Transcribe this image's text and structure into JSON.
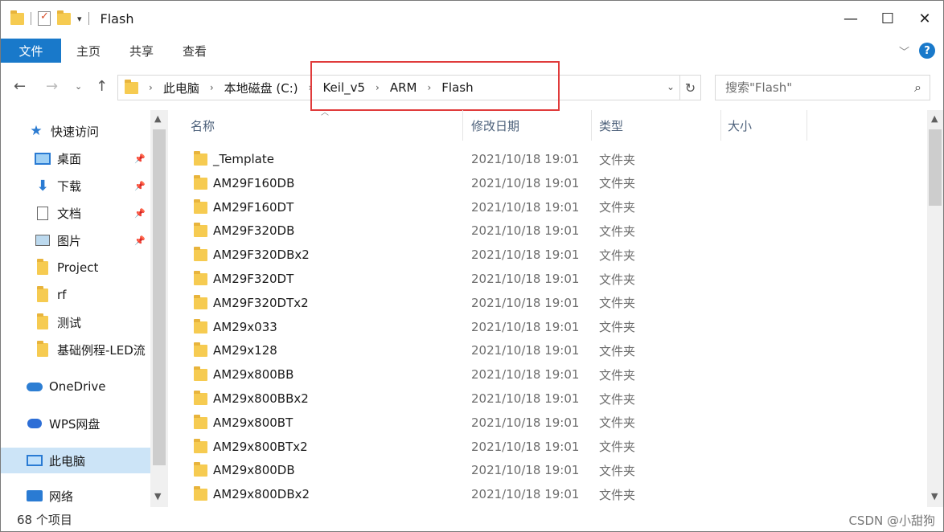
{
  "window": {
    "title": "Flash",
    "minimize": "—",
    "maximize": "☐",
    "close": "✕"
  },
  "ribbon": {
    "file": "文件",
    "tabs": [
      "主页",
      "共享",
      "查看"
    ]
  },
  "address": {
    "crumbs": [
      "此电脑",
      "本地磁盘 (C:)",
      "Keil_v5",
      "ARM",
      "Flash"
    ]
  },
  "search": {
    "placeholder": "搜索\"Flash\""
  },
  "sidebar": {
    "items": [
      {
        "label": "快速访问",
        "icon": "star-icon"
      },
      {
        "label": "桌面",
        "icon": "desktop-icon",
        "pinned": true
      },
      {
        "label": "下载",
        "icon": "download-icon",
        "pinned": true
      },
      {
        "label": "文档",
        "icon": "document-icon",
        "pinned": true
      },
      {
        "label": "图片",
        "icon": "pictures-icon",
        "pinned": true
      },
      {
        "label": "Project",
        "icon": "folder-icon"
      },
      {
        "label": "rf",
        "icon": "folder-icon"
      },
      {
        "label": "测试",
        "icon": "folder-icon"
      },
      {
        "label": "基础例程-LED流",
        "icon": "folder-icon"
      },
      {
        "label": "OneDrive",
        "icon": "onedrive-icon"
      },
      {
        "label": "WPS网盘",
        "icon": "wps-cloud-icon"
      },
      {
        "label": "此电脑",
        "icon": "this-pc-icon",
        "selected": true
      },
      {
        "label": "网络",
        "icon": "network-icon"
      }
    ]
  },
  "columns": {
    "name": "名称",
    "date": "修改日期",
    "type": "类型",
    "size": "大小"
  },
  "files": [
    {
      "name": "_Template",
      "date": "2021/10/18 19:01",
      "type": "文件夹"
    },
    {
      "name": "AM29F160DB",
      "date": "2021/10/18 19:01",
      "type": "文件夹"
    },
    {
      "name": "AM29F160DT",
      "date": "2021/10/18 19:01",
      "type": "文件夹"
    },
    {
      "name": "AM29F320DB",
      "date": "2021/10/18 19:01",
      "type": "文件夹"
    },
    {
      "name": "AM29F320DBx2",
      "date": "2021/10/18 19:01",
      "type": "文件夹"
    },
    {
      "name": "AM29F320DT",
      "date": "2021/10/18 19:01",
      "type": "文件夹"
    },
    {
      "name": "AM29F320DTx2",
      "date": "2021/10/18 19:01",
      "type": "文件夹"
    },
    {
      "name": "AM29x033",
      "date": "2021/10/18 19:01",
      "type": "文件夹"
    },
    {
      "name": "AM29x128",
      "date": "2021/10/18 19:01",
      "type": "文件夹"
    },
    {
      "name": "AM29x800BB",
      "date": "2021/10/18 19:01",
      "type": "文件夹"
    },
    {
      "name": "AM29x800BBx2",
      "date": "2021/10/18 19:01",
      "type": "文件夹"
    },
    {
      "name": "AM29x800BT",
      "date": "2021/10/18 19:01",
      "type": "文件夹"
    },
    {
      "name": "AM29x800BTx2",
      "date": "2021/10/18 19:01",
      "type": "文件夹"
    },
    {
      "name": "AM29x800DB",
      "date": "2021/10/18 19:01",
      "type": "文件夹"
    },
    {
      "name": "AM29x800DBx2",
      "date": "2021/10/18 19:01",
      "type": "文件夹"
    }
  ],
  "status": {
    "count": "68 个项目"
  },
  "watermark": "CSDN @小甜狗",
  "colors": {
    "accent": "#1979ca",
    "highlight_box": "#e03b3b",
    "selected": "#cce4f7",
    "folder": "#f6cb51"
  }
}
